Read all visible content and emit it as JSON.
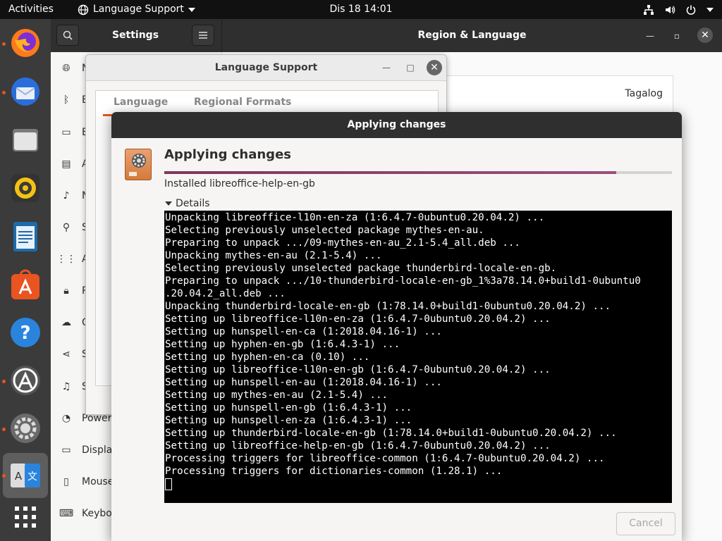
{
  "topbar": {
    "activities": "Activities",
    "app_menu": "Language Support",
    "clock": "Dis 18  14:01"
  },
  "dock": {
    "items": [
      "firefox",
      "thunderbird",
      "files",
      "rhythmbox",
      "libreoffice-writer",
      "ubuntu-software",
      "help",
      "software-updater",
      "settings",
      "language-support",
      "show-applications"
    ]
  },
  "settings": {
    "title": "Settings",
    "panel_title": "Region & Language",
    "sidebar": [
      {
        "icon": "network-icon",
        "label": "N"
      },
      {
        "icon": "bluetooth-icon",
        "label": "B"
      },
      {
        "icon": "background-icon",
        "label": "B"
      },
      {
        "icon": "appearance-icon",
        "label": "A"
      },
      {
        "icon": "notifications-icon",
        "label": "N"
      },
      {
        "icon": "search-icon",
        "label": "S"
      },
      {
        "icon": "applications-icon",
        "label": "A"
      },
      {
        "icon": "privacy-icon",
        "label": "P"
      },
      {
        "icon": "online-accounts-icon",
        "label": "O"
      },
      {
        "icon": "sharing-icon",
        "label": "S"
      },
      {
        "icon": "sound-icon",
        "label": "S"
      },
      {
        "icon": "power-icon",
        "label": "Power"
      },
      {
        "icon": "display-icon",
        "label": "Display"
      },
      {
        "icon": "mouse-icon",
        "label": "Mouse"
      },
      {
        "icon": "keyboard-icon",
        "label": "Keyboa"
      }
    ],
    "region_value": "Tagalog"
  },
  "language_support": {
    "title": "Language Support",
    "tabs": [
      "Language",
      "Regional Formats"
    ]
  },
  "applying": {
    "window_title": "Applying changes",
    "heading": "Applying changes",
    "progress": 0.89,
    "status": "Installed libreoffice-help-en-gb",
    "details_label": "Details",
    "terminal_lines": [
      "Unpacking libreoffice-l10n-en-za (1:6.4.7-0ubuntu0.20.04.2) ...",
      "Selecting previously unselected package mythes-en-au.",
      "Preparing to unpack .../09-mythes-en-au_2.1-5.4_all.deb ...",
      "Unpacking mythes-en-au (2.1-5.4) ...",
      "Selecting previously unselected package thunderbird-locale-en-gb.",
      "Preparing to unpack .../10-thunderbird-locale-en-gb_1%3a78.14.0+build1-0ubuntu0",
      ".20.04.2_all.deb ...",
      "Unpacking thunderbird-locale-en-gb (1:78.14.0+build1-0ubuntu0.20.04.2) ...",
      "Setting up libreoffice-l10n-en-za (1:6.4.7-0ubuntu0.20.04.2) ...",
      "Setting up hunspell-en-ca (1:2018.04.16-1) ...",
      "Setting up hyphen-en-gb (1:6.4.3-1) ...",
      "Setting up hyphen-en-ca (0.10) ...",
      "Setting up libreoffice-l10n-en-gb (1:6.4.7-0ubuntu0.20.04.2) ...",
      "Setting up hunspell-en-au (1:2018.04.16-1) ...",
      "Setting up mythes-en-au (2.1-5.4) ...",
      "Setting up hunspell-en-gb (1:6.4.3-1) ...",
      "Setting up hunspell-en-za (1:6.4.3-1) ...",
      "Setting up thunderbird-locale-en-gb (1:78.14.0+build1-0ubuntu0.20.04.2) ...",
      "Setting up libreoffice-help-en-gb (1:6.4.7-0ubuntu0.20.04.2) ...",
      "Processing triggers for libreoffice-common (1:6.4.7-0ubuntu0.20.04.2) ...",
      "Processing triggers for dictionaries-common (1.28.1) ..."
    ],
    "cancel_label": "Cancel"
  }
}
